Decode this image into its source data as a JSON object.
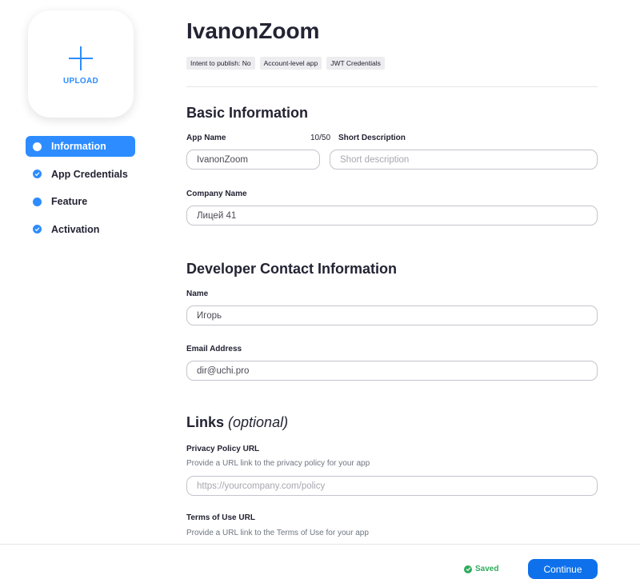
{
  "upload": {
    "label": "UPLOAD"
  },
  "nav": {
    "items": [
      {
        "label": "Information",
        "active": true,
        "icon": "dot"
      },
      {
        "label": "App Credentials",
        "active": false,
        "icon": "check"
      },
      {
        "label": "Feature",
        "active": false,
        "icon": "dot"
      },
      {
        "label": "Activation",
        "active": false,
        "icon": "check"
      }
    ]
  },
  "app": {
    "title": "IvanonZoom",
    "tags": [
      "Intent to publish: No",
      "Account-level app",
      "JWT Credentials"
    ]
  },
  "basic": {
    "heading": "Basic Information",
    "app_name_label": "App Name",
    "app_name_counter": "10/50",
    "app_name_value": "IvanonZoom",
    "short_desc_label": "Short Description",
    "short_desc_placeholder": "Short description",
    "company_label": "Company Name",
    "company_value": "Лицей 41"
  },
  "developer": {
    "heading": "Developer Contact Information",
    "name_label": "Name",
    "name_value": "Игорь",
    "email_label": "Email Address",
    "email_value": "dir@uchi.pro"
  },
  "links": {
    "heading": "Links",
    "heading_optional": "(optional)",
    "privacy_label": "Privacy Policy URL",
    "privacy_helper": "Provide a URL link to the privacy policy for your app",
    "privacy_placeholder": "https://yourcompany.com/policy",
    "terms_label": "Terms of Use URL",
    "terms_helper": "Provide a URL link to the Terms of Use for your app"
  },
  "footer": {
    "saved_label": "Saved",
    "continue_label": "Continue"
  },
  "colors": {
    "accent": "#2D8CFF",
    "button": "#0E71EB",
    "saved": "#2eac5d"
  }
}
